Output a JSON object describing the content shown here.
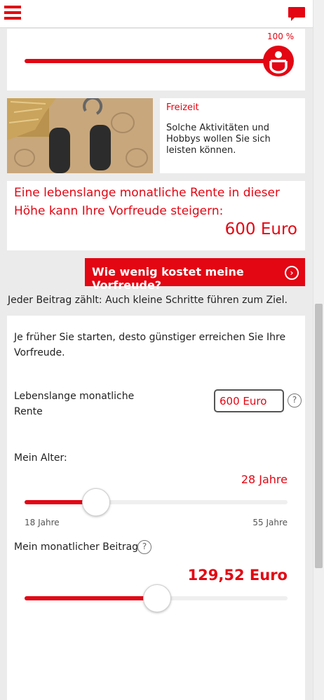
{
  "colors": {
    "accent": "#e30613",
    "background": "#ebebeb"
  },
  "header": {
    "menu_icon": "hamburger-icon",
    "chat_icon": "chat-icon"
  },
  "top_slider": {
    "percent_label": "100 %",
    "value_fraction": 1.0
  },
  "activity": {
    "category": "Freizeit",
    "description": "Solche Aktivitäten und Hobbys wollen Sie sich leisten können."
  },
  "rente": {
    "text": "Eine lebenslange monatliche Rente in dieser Höhe kann Ihre Vorfreude steigern:",
    "amount": "600 Euro"
  },
  "cta": {
    "label": "Wie wenig kostet meine Vorfreude?",
    "arrow": "›"
  },
  "tagline": "Jeder Beitrag zählt: Auch kleine Schritte führen zum Ziel.",
  "calculator": {
    "intro": "Je früher Sie starten, desto günstiger erreichen Sie Ihre Vorfreude.",
    "rente_label": "Lebenslange monatliche Rente",
    "rente_value": "600 Euro",
    "help": "?",
    "age_label": "Mein Alter:",
    "age_value": "28 Jahre",
    "age_min": "18 Jahre",
    "age_max": "55 Jahre",
    "age_fraction": 0.27,
    "contribution_label": "Mein monatlicher Beitrag:",
    "contribution_value": "129,52 Euro",
    "contribution_fraction": 0.5
  }
}
